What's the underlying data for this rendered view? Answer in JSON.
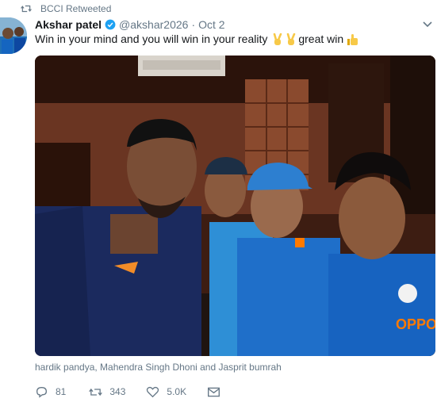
{
  "retweet_context": {
    "label": "BCCI Retweeted"
  },
  "author": {
    "name": "Akshar patel",
    "handle": "@akshar2026",
    "separator": "·",
    "date": "Oct 2"
  },
  "tweet": {
    "text_main": "Win in your mind and you will win in your reality",
    "text_tail": "great win",
    "emojis": [
      "victory-hand",
      "victory-hand",
      "thumbs-up"
    ]
  },
  "media": {
    "caption": "hardik pandya, Mahendra Singh Dhoni and Jasprit bumrah"
  },
  "actions": {
    "replies": "81",
    "retweets": "343",
    "likes": "5.0K"
  },
  "colors": {
    "muted": "#657786",
    "verified": "#1da1f2",
    "text": "#14171a"
  }
}
